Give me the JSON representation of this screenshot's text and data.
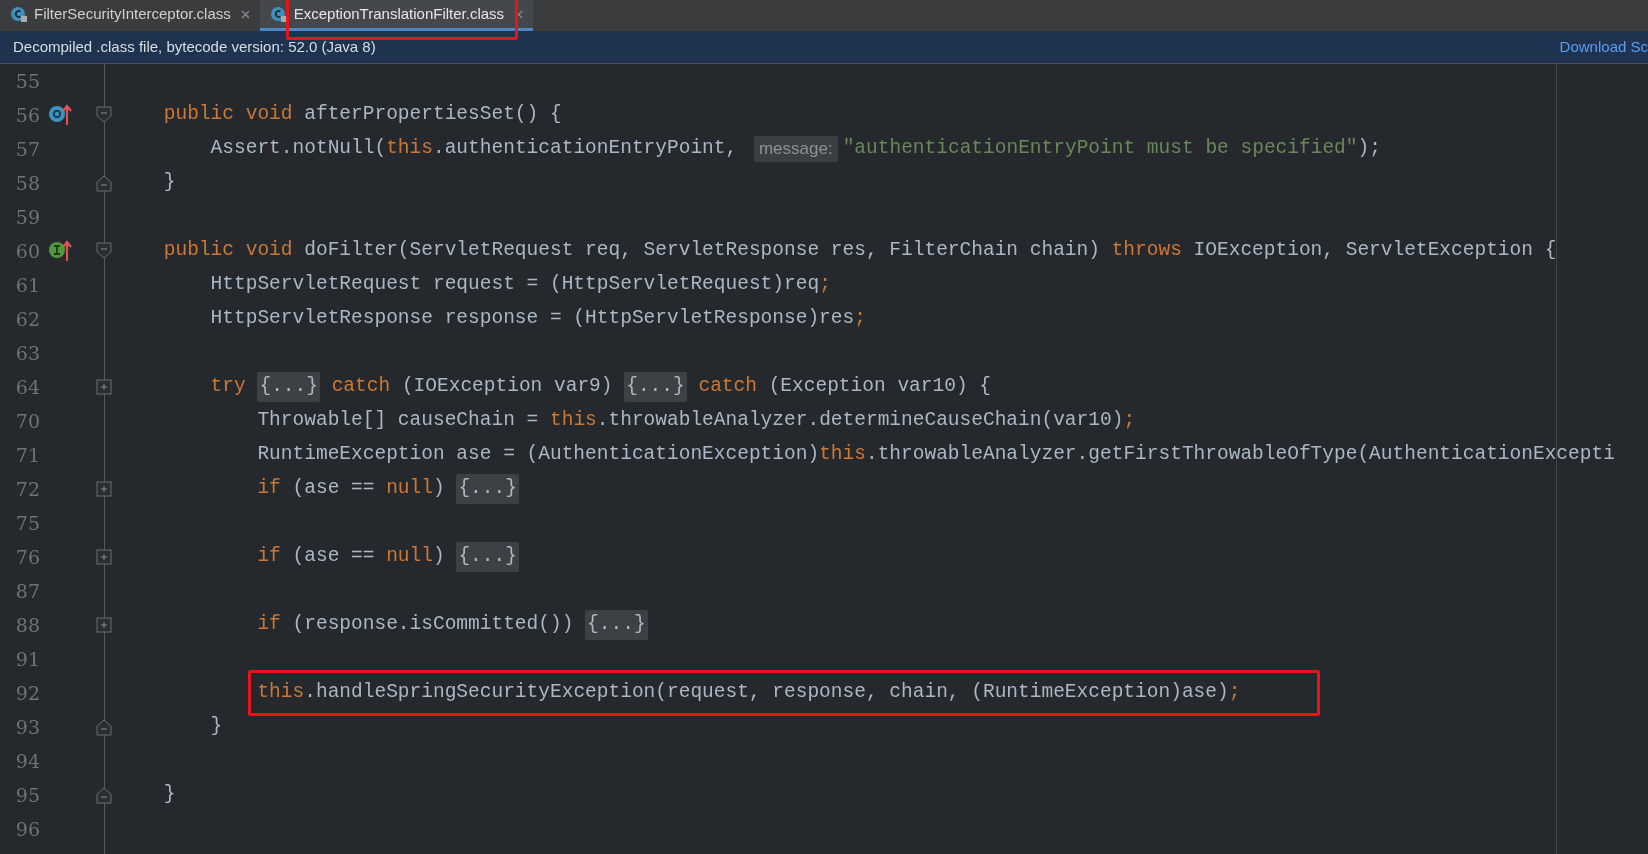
{
  "tabs": [
    {
      "label": "FilterSecurityInterceptor.class",
      "selected": false,
      "annotated": false
    },
    {
      "label": "ExceptionTranslationFilter.class",
      "selected": true,
      "annotated": true
    }
  ],
  "banner": {
    "text": "Decompiled .class file, bytecode version: 52.0 (Java 8)",
    "link": "Download Sc"
  },
  "lines": [
    {
      "number": "55"
    },
    {
      "number": "56",
      "gutter_icon": {
        "kind": "override"
      },
      "fold": {
        "kind": "open"
      },
      "segments": [
        {
          "kind": "keyword",
          "text": "    public void "
        },
        {
          "kind": "plain",
          "text": "afterPropertiesSet() {"
        }
      ]
    },
    {
      "number": "57",
      "segments": [
        {
          "kind": "plain",
          "text": "        Assert.notNull("
        },
        {
          "kind": "keyword",
          "text": "this"
        },
        {
          "kind": "plain",
          "text": ".authenticationEntryPoint, "
        },
        {
          "kind": "hint",
          "text": "message:"
        },
        {
          "kind": "string",
          "text": "\"authenticationEntryPoint must be specified\""
        },
        {
          "kind": "plain",
          "text": ");"
        }
      ]
    },
    {
      "number": "58",
      "fold": {
        "kind": "close"
      },
      "segments": [
        {
          "kind": "plain",
          "text": "    }"
        }
      ]
    },
    {
      "number": "59"
    },
    {
      "number": "60",
      "gutter_icon": {
        "kind": "implements"
      },
      "fold": {
        "kind": "open"
      },
      "segments": [
        {
          "kind": "keyword",
          "text": "    public void "
        },
        {
          "kind": "plain",
          "text": "doFilter(ServletRequest req, ServletResponse res, FilterChain chain) "
        },
        {
          "kind": "keyword",
          "text": "throws "
        },
        {
          "kind": "plain",
          "text": "IOException, ServletException {"
        }
      ]
    },
    {
      "number": "61",
      "segments": [
        {
          "kind": "plain",
          "text": "        HttpServletRequest request = (HttpServletRequest)req"
        },
        {
          "kind": "keyword",
          "text": ";"
        }
      ]
    },
    {
      "number": "62",
      "segments": [
        {
          "kind": "plain",
          "text": "        HttpServletResponse response = (HttpServletResponse)res"
        },
        {
          "kind": "keyword",
          "text": ";"
        }
      ]
    },
    {
      "number": "63"
    },
    {
      "number": "64",
      "fold": {
        "kind": "collapsed"
      },
      "segments": [
        {
          "kind": "keyword",
          "text": "        try "
        },
        {
          "kind": "folded",
          "text": "{...}"
        },
        {
          "kind": "keyword",
          "text": " catch "
        },
        {
          "kind": "plain",
          "text": "(IOException var9) "
        },
        {
          "kind": "folded",
          "text": "{...}"
        },
        {
          "kind": "keyword",
          "text": " catch "
        },
        {
          "kind": "plain",
          "text": "(Exception var10) {"
        }
      ]
    },
    {
      "number": "70",
      "segments": [
        {
          "kind": "plain",
          "text": "            Throwable[] causeChain = "
        },
        {
          "kind": "keyword",
          "text": "this"
        },
        {
          "kind": "plain",
          "text": ".throwableAnalyzer.determineCauseChain(var10)"
        },
        {
          "kind": "keyword",
          "text": ";"
        }
      ]
    },
    {
      "number": "71",
      "segments": [
        {
          "kind": "plain",
          "text": "            RuntimeException ase = (AuthenticationException)"
        },
        {
          "kind": "keyword",
          "text": "this"
        },
        {
          "kind": "plain",
          "text": ".throwableAnalyzer.getFirstThrowableOfType(AuthenticationExcepti"
        }
      ]
    },
    {
      "number": "72",
      "fold": {
        "kind": "collapsed"
      },
      "segments": [
        {
          "kind": "keyword",
          "text": "            if "
        },
        {
          "kind": "plain",
          "text": "(ase == "
        },
        {
          "kind": "keyword",
          "text": "null"
        },
        {
          "kind": "plain",
          "text": ") "
        },
        {
          "kind": "folded",
          "text": "{...}"
        }
      ]
    },
    {
      "number": "75"
    },
    {
      "number": "76",
      "fold": {
        "kind": "collapsed"
      },
      "segments": [
        {
          "kind": "keyword",
          "text": "            if "
        },
        {
          "kind": "plain",
          "text": "(ase == "
        },
        {
          "kind": "keyword",
          "text": "null"
        },
        {
          "kind": "plain",
          "text": ") "
        },
        {
          "kind": "folded",
          "text": "{...}"
        }
      ]
    },
    {
      "number": "87"
    },
    {
      "number": "88",
      "fold": {
        "kind": "collapsed"
      },
      "segments": [
        {
          "kind": "keyword",
          "text": "            if "
        },
        {
          "kind": "plain",
          "text": "(response.isCommitted()) "
        },
        {
          "kind": "folded",
          "text": "{...}"
        }
      ]
    },
    {
      "number": "91"
    },
    {
      "number": "92",
      "annotated": true,
      "segments": [
        {
          "kind": "keyword",
          "text": "            this"
        },
        {
          "kind": "plain",
          "text": ".handleSpringSecurityException(request, response, chain, (RuntimeException)ase)"
        },
        {
          "kind": "keyword",
          "text": ";"
        }
      ]
    },
    {
      "number": "93",
      "fold": {
        "kind": "close"
      },
      "segments": [
        {
          "kind": "plain",
          "text": "        }"
        }
      ]
    },
    {
      "number": "94"
    },
    {
      "number": "95",
      "fold": {
        "kind": "close"
      },
      "segments": [
        {
          "kind": "plain",
          "text": "    }"
        }
      ]
    },
    {
      "number": "96"
    }
  ]
}
